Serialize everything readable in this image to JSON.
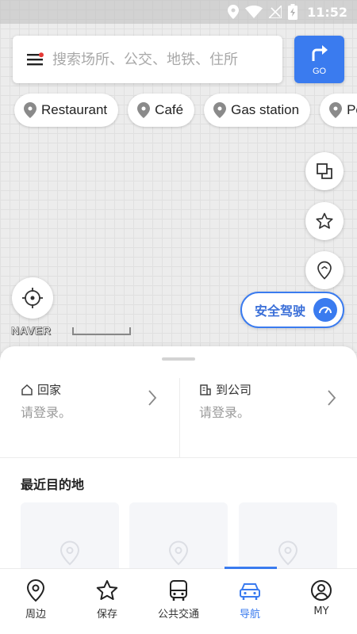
{
  "status_bar": {
    "time": "11:52"
  },
  "search": {
    "placeholder": "搜索场所、公交、地铁、住所"
  },
  "go_button": {
    "label": "GO"
  },
  "chips": [
    {
      "label": "Restaurant"
    },
    {
      "label": "Café"
    },
    {
      "label": "Gas station"
    },
    {
      "label": "Pe"
    }
  ],
  "map": {
    "logo": "NAVER",
    "safe_drive_label": "安全驾驶"
  },
  "sheet": {
    "home_label": "回家",
    "home_sub": "请登录。",
    "work_label": "到公司",
    "work_sub": "请登录。",
    "recent_title": "最近目的地"
  },
  "bottom_nav": [
    {
      "label": "周边"
    },
    {
      "label": "保存"
    },
    {
      "label": "公共交通"
    },
    {
      "label": "导航"
    },
    {
      "label": "MY"
    }
  ],
  "colors": {
    "accent": "#3a7bef",
    "text_muted": "#9a9a9a"
  }
}
